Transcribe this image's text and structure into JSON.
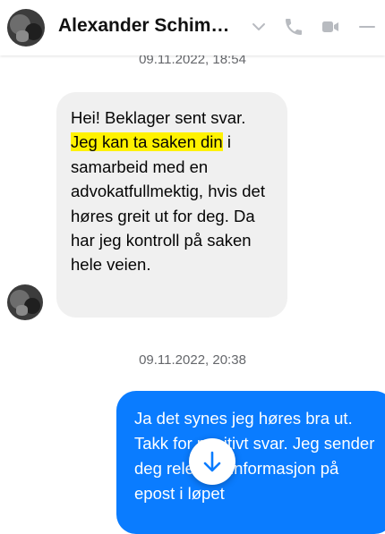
{
  "header": {
    "contact_name": "Alexander Schim…",
    "icons": [
      "chevron-down-icon",
      "phone-icon",
      "video-icon",
      "minimize-icon"
    ],
    "accent_color": "#0a7cff"
  },
  "messages": [
    {
      "timestamp": "09.11.2022, 18:54"
    },
    {
      "direction": "incoming",
      "text_before": "Hei! Beklager sent svar. ",
      "text_highlight": "Jeg kan ta saken din",
      "text_after": " i samarbeid med en advokatfullmektig, hvis det høres greit ut for deg. Da har jeg kontroll på saken hele veien.",
      "highlight_color": "#fff200"
    },
    {
      "timestamp": "09.11.2022, 20:38"
    },
    {
      "direction": "outgoing",
      "text": "Ja det synes jeg høres bra ut. Takk for positivt svar. Jeg sender deg relevant informasjon på epost i løpet"
    }
  ],
  "scroll_button": {
    "icon": "arrow-down-icon"
  }
}
